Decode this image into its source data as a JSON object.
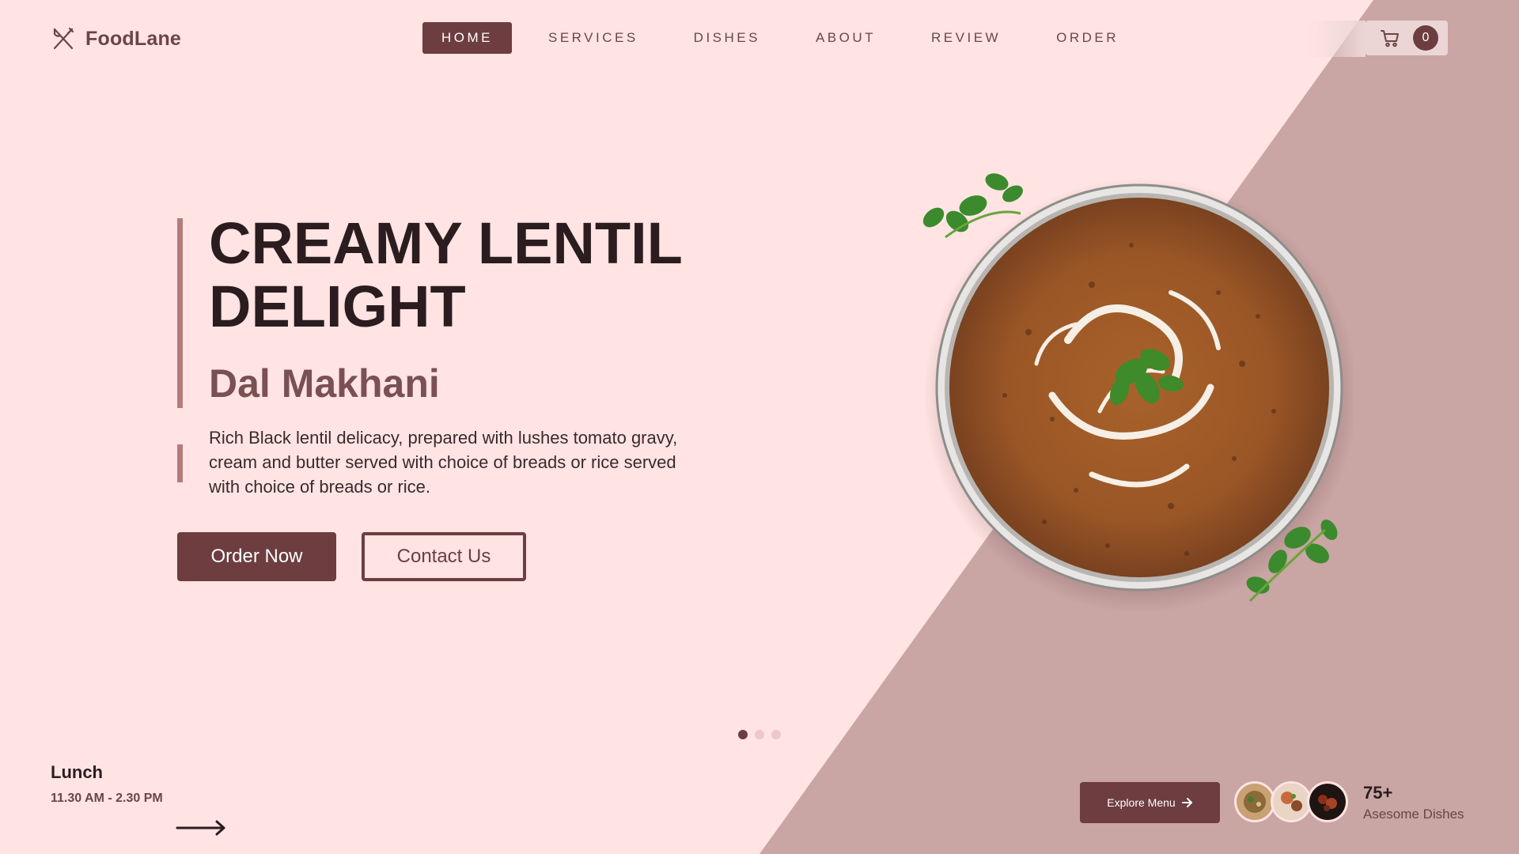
{
  "brand": {
    "name": "FoodLane",
    "logo_icon": "fork-knife-icon"
  },
  "nav": {
    "items": [
      {
        "label": "HOME",
        "active": true
      },
      {
        "label": "SERVICES",
        "active": false
      },
      {
        "label": "DISHES",
        "active": false
      },
      {
        "label": "ABOUT",
        "active": false
      },
      {
        "label": "REVIEW",
        "active": false
      },
      {
        "label": "ORDER",
        "active": false
      }
    ],
    "cart": {
      "icon": "cart-icon",
      "count": "0"
    }
  },
  "hero": {
    "title": "CREAMY LENTIL DELIGHT",
    "subtitle": "Dal Makhani",
    "description": "Rich Black lentil delicacy, prepared with lushes tomato gravy, cream and butter served with choice of breads or rice served with choice of breads or rice.",
    "buttons": {
      "order": "Order Now",
      "contact": "Contact Us"
    },
    "slides": {
      "count": 3,
      "active": 1
    }
  },
  "hours": {
    "label": "Lunch",
    "time": "11.30 AM - 2.30 PM"
  },
  "explore": {
    "label": "Explore Menu",
    "icon": "arrow-right-icon"
  },
  "stats": {
    "number": "75+",
    "label": "Asesome Dishes"
  },
  "colors": {
    "background": "#ffe4e3",
    "diagonal_panel": "#c9a5a4",
    "accent": "#6d3d40",
    "bar": "#b57b7c",
    "text_dark": "#2b1d1f"
  }
}
